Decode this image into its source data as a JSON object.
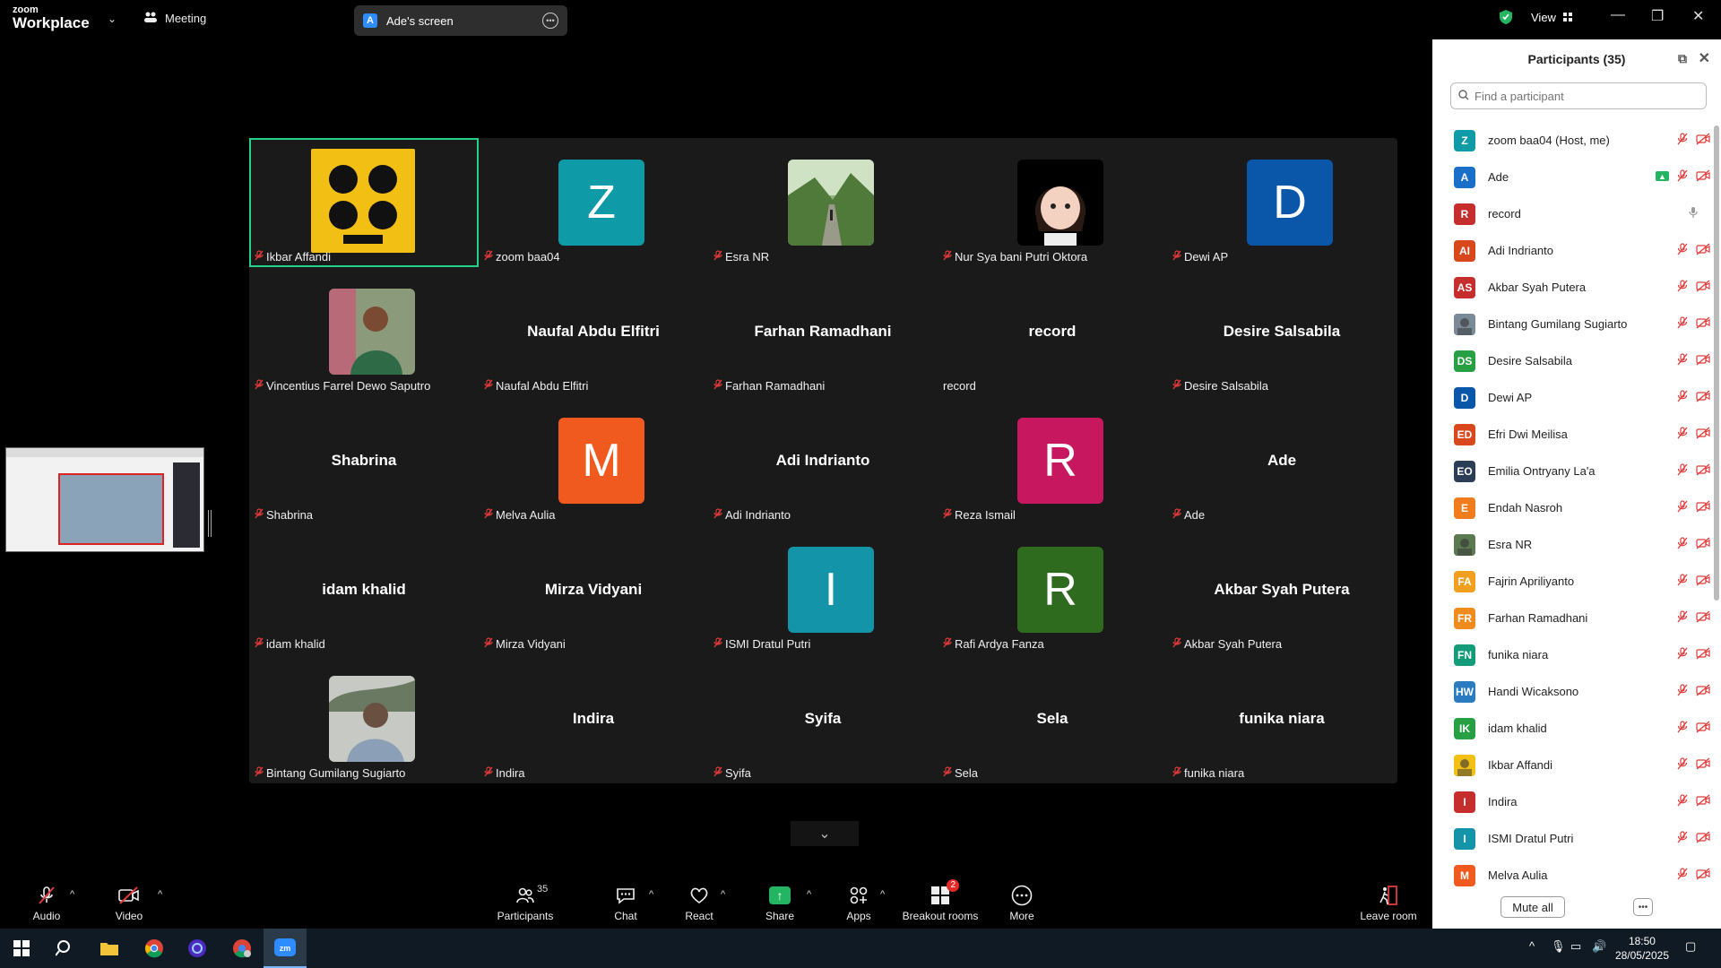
{
  "app": {
    "logo_line1": "zoom",
    "logo_line2": "Workplace",
    "meeting_label": "Meeting",
    "screen_tab": {
      "avatar": "A",
      "label": "Ade's screen"
    },
    "view_label": "View"
  },
  "colors": {
    "active_border": "#23d18b",
    "muted_red": "#e03a3a",
    "share_green": "#23b561",
    "tile_bg": "#1a1a1a"
  },
  "grid": [
    {
      "name": "Ikbar Affandi",
      "type": "image",
      "image": "beatles",
      "active": true
    },
    {
      "name": "zoom baa04",
      "type": "letter",
      "letter": "Z",
      "color": "#0e9aa7"
    },
    {
      "name": "Esra NR",
      "type": "image",
      "image": "park"
    },
    {
      "name": "Nur Sya bani Putri Oktora",
      "type": "image",
      "image": "avatar-girl"
    },
    {
      "name": "Dewi AP",
      "type": "letter",
      "letter": "D",
      "color": "#0a56a8"
    },
    {
      "name": "Vincentius Farrel Dewo Saputro",
      "type": "image",
      "image": "person-green"
    },
    {
      "name": "Naufal Abdu Elfitri",
      "type": "name",
      "display": "Naufal Abdu Elfitri"
    },
    {
      "name": "Farhan Ramadhani",
      "type": "name",
      "display": "Farhan Ramadhani"
    },
    {
      "name": "record",
      "type": "name",
      "display": "record",
      "unmuted": true
    },
    {
      "name": "Desire Salsabila",
      "type": "name",
      "display": "Desire Salsabila"
    },
    {
      "name": "Shabrina",
      "type": "name",
      "display": "Shabrina"
    },
    {
      "name": "Melva Aulia",
      "type": "letter",
      "letter": "M",
      "color": "#f05a1e"
    },
    {
      "name": "Adi Indrianto",
      "type": "name",
      "display": "Adi Indrianto"
    },
    {
      "name": "Reza Ismail",
      "type": "letter",
      "letter": "R",
      "color": "#c7175f"
    },
    {
      "name": "Ade",
      "type": "name",
      "display": "Ade"
    },
    {
      "name": "idam khalid",
      "type": "name",
      "display": "idam khalid"
    },
    {
      "name": "Mirza Vidyani",
      "type": "name",
      "display": "Mirza Vidyani"
    },
    {
      "name": "ISMI Dratul Putri",
      "type": "letter",
      "letter": "I",
      "color": "#1394a8"
    },
    {
      "name": "Rafi Ardya Fanza",
      "type": "letter",
      "letter": "R",
      "color": "#2e6b1e"
    },
    {
      "name": "Akbar Syah Putera",
      "type": "name",
      "display": "Akbar Syah Putera"
    },
    {
      "name": "Bintang Gumilang Sugiarto",
      "type": "image",
      "image": "person-outdoor"
    },
    {
      "name": "Indira",
      "type": "name",
      "display": "Indira"
    },
    {
      "name": "Syifa",
      "type": "name",
      "display": "Syifa"
    },
    {
      "name": "Sela",
      "type": "name",
      "display": "Sela"
    },
    {
      "name": "funika niara",
      "type": "name",
      "display": "funika niara"
    }
  ],
  "panel": {
    "title": "Participants (35)",
    "search_placeholder": "Find a participant",
    "mute_all": "Mute all",
    "participants": [
      {
        "name": "zoom baa04 (Host, me)",
        "initials": "Z",
        "color": "#0e9aa7"
      },
      {
        "name": "Ade",
        "initials": "A",
        "color": "#1a6fc9",
        "sharing": true
      },
      {
        "name": "record",
        "initials": "R",
        "color": "#c62d2d",
        "unmuted": true
      },
      {
        "name": "Adi Indrianto",
        "initials": "AI",
        "color": "#d9481c"
      },
      {
        "name": "Akbar Syah Putera",
        "initials": "AS",
        "color": "#c62d2d"
      },
      {
        "name": "Bintang Gumilang Sugiarto",
        "initials": "",
        "color": "#7a8a99",
        "photo": true
      },
      {
        "name": "Desire Salsabila",
        "initials": "DS",
        "color": "#27a043"
      },
      {
        "name": "Dewi AP",
        "initials": "D",
        "color": "#0a56a8"
      },
      {
        "name": "Efri Dwi Meilisa",
        "initials": "ED",
        "color": "#d9481c"
      },
      {
        "name": "Emilia Ontryany La'a",
        "initials": "EO",
        "color": "#2c3e55"
      },
      {
        "name": "Endah Nasroh",
        "initials": "E",
        "color": "#f07c1e"
      },
      {
        "name": "Esra NR",
        "initials": "",
        "color": "#5c7a52",
        "photo": true
      },
      {
        "name": "Fajrin Apriliyanto",
        "initials": "FA",
        "color": "#f0a01e"
      },
      {
        "name": "Farhan Ramadhani",
        "initials": "FR",
        "color": "#f08c1e"
      },
      {
        "name": "funika niara",
        "initials": "FN",
        "color": "#139b7a"
      },
      {
        "name": "Handi Wicaksono",
        "initials": "HW",
        "color": "#2a7bc0"
      },
      {
        "name": "idam khalid",
        "initials": "IK",
        "color": "#27a043"
      },
      {
        "name": "Ikbar Affandi",
        "initials": "",
        "color": "#f2c014",
        "photo": true
      },
      {
        "name": "Indira",
        "initials": "I",
        "color": "#c62d2d"
      },
      {
        "name": "ISMI Dratul Putri",
        "initials": "I",
        "color": "#1394a8"
      },
      {
        "name": "Melva Aulia",
        "initials": "M",
        "color": "#f05a1e"
      }
    ]
  },
  "toolbar": {
    "audio": "Audio",
    "video": "Video",
    "participants": "Participants",
    "participants_count": "35",
    "chat": "Chat",
    "react": "React",
    "share": "Share",
    "apps": "Apps",
    "breakout": "Breakout rooms",
    "breakout_badge": "2",
    "more": "More",
    "leave": "Leave room"
  },
  "taskbar": {
    "time": "18:50",
    "date": "28/05/2025"
  }
}
